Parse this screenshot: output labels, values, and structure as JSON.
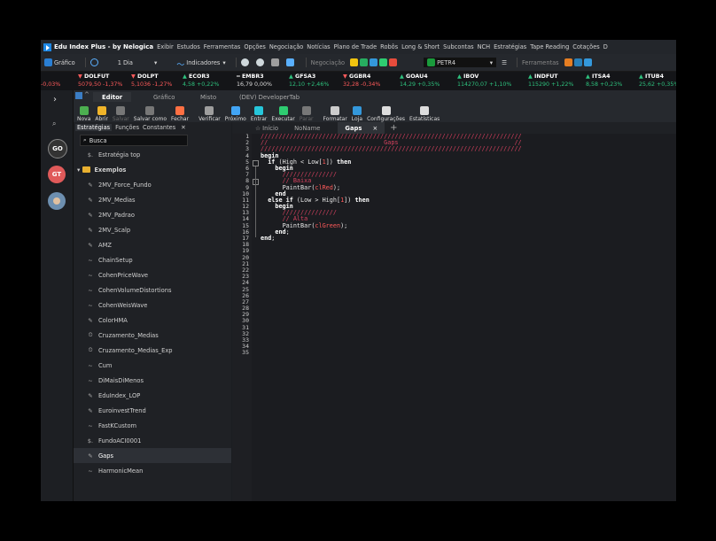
{
  "app": {
    "title": "Edu Index Plus - by Nelogica",
    "menu": [
      "Exibir",
      "Estudos",
      "Ferramentas",
      "Opções",
      "Negociação",
      "Notícias",
      "Plano de Trade",
      "Robôs",
      "Long & Short",
      "Subcontas",
      "NCH",
      "Estratégias",
      "Tape Reading",
      "Cotações",
      "D"
    ]
  },
  "toolbar": {
    "chart_label": "Gráfico",
    "interval": "1 Dia",
    "indicators_label": "Indicadores",
    "trading_label": "Negociação",
    "symbol": "PETR4",
    "tools_label": "Ferramentas"
  },
  "tickers": [
    {
      "name": "",
      "value": "",
      "change": "-0,03%",
      "dir": "down"
    },
    {
      "name": "DOLFUT",
      "value": "5079,50",
      "change": "-1,37%",
      "dir": "down"
    },
    {
      "name": "DOLPT",
      "value": "5,1036",
      "change": "-1,27%",
      "dir": "down"
    },
    {
      "name": "ECOR3",
      "value": "4,58",
      "change": "+0,22%",
      "dir": "up"
    },
    {
      "name": "EMBR3",
      "value": "16,79",
      "change": "0,00%",
      "dir": "flat"
    },
    {
      "name": "GFSA3",
      "value": "12,10",
      "change": "+2,46%",
      "dir": "up"
    },
    {
      "name": "GGBR4",
      "value": "32,28",
      "change": "-0,34%",
      "dir": "down"
    },
    {
      "name": "GOAU4",
      "value": "14,29",
      "change": "+0,35%",
      "dir": "up"
    },
    {
      "name": "IBOV",
      "value": "114270,07",
      "change": "+1,10%",
      "dir": "up"
    },
    {
      "name": "INDFUT",
      "value": "115290",
      "change": "+1,22%",
      "dir": "up"
    },
    {
      "name": "ITSA4",
      "value": "8,58",
      "change": "+0,23%",
      "dir": "up"
    },
    {
      "name": "ITUB4",
      "value": "25,62",
      "change": "+0,35%",
      "dir": "up"
    }
  ],
  "leftnav": {
    "badges": [
      "GO",
      "GT"
    ]
  },
  "editor_tabs": [
    "Editor",
    "Gráfico",
    "Misto",
    "(DEV) DeveloperTab"
  ],
  "ribbon": [
    {
      "label": "Nova",
      "color": "#4caf50"
    },
    {
      "label": "Abrir",
      "color": "#f0b429"
    },
    {
      "label": "Salvar",
      "color": "#777",
      "disabled": true
    },
    {
      "label": "Salvar como",
      "color": "#777"
    },
    {
      "label": "Fechar",
      "color": "#ff7043"
    },
    {
      "label": "Verificar",
      "color": "#9e9e9e"
    },
    {
      "label": "Próximo",
      "color": "#42a5f5"
    },
    {
      "label": "Entrar",
      "color": "#26c6da"
    },
    {
      "label": "Executar",
      "color": "#2ecc71"
    },
    {
      "label": "Parar",
      "color": "#777",
      "disabled": true
    },
    {
      "label": "Formatar",
      "color": "#ccc"
    },
    {
      "label": "Loja",
      "color": "#3498db"
    },
    {
      "label": "Configurações",
      "color": "#ddd"
    },
    {
      "label": "Estatísticas",
      "color": "#ddd"
    }
  ],
  "panel": {
    "tabs": [
      "Estratégias",
      "Funções",
      "Constantes"
    ],
    "search_placeholder": "Busca",
    "items": [
      {
        "label": "Estratégia top",
        "icon": "$",
        "type": "strategy"
      },
      {
        "label": "Exemplos",
        "icon": "folder",
        "type": "folder"
      },
      {
        "label": "2MV_Force_Fundo",
        "icon": "✎",
        "type": "item"
      },
      {
        "label": "2MV_Medias",
        "icon": "✎",
        "type": "item"
      },
      {
        "label": "2MV_Padrao",
        "icon": "✎",
        "type": "item"
      },
      {
        "label": "2MV_Scalp",
        "icon": "✎",
        "type": "item"
      },
      {
        "label": "AMZ",
        "icon": "✎",
        "type": "item"
      },
      {
        "label": "ChainSetup",
        "icon": "~",
        "type": "item"
      },
      {
        "label": "CohenPriceWave",
        "icon": "~",
        "type": "item"
      },
      {
        "label": "CohenVolumeDistortions",
        "icon": "~",
        "type": "item"
      },
      {
        "label": "CohenWeisWave",
        "icon": "~",
        "type": "item"
      },
      {
        "label": "ColorHMA",
        "icon": "✎",
        "type": "item"
      },
      {
        "label": "Cruzamento_Medias",
        "icon": "⏲",
        "type": "item"
      },
      {
        "label": "Cruzamento_Medias_Exp",
        "icon": "⏲",
        "type": "item"
      },
      {
        "label": "Cum",
        "icon": "~",
        "type": "item"
      },
      {
        "label": "DiMaisDiMenos",
        "icon": "~",
        "type": "item"
      },
      {
        "label": "EduIndex_LOP",
        "icon": "✎",
        "type": "item"
      },
      {
        "label": "EuroinvestTrend",
        "icon": "✎",
        "type": "item"
      },
      {
        "label": "FastKCustom",
        "icon": "~",
        "type": "item"
      },
      {
        "label": "FundoACI0001",
        "icon": "$",
        "type": "strategy"
      },
      {
        "label": "Gaps",
        "icon": "✎",
        "type": "item",
        "selected": true
      },
      {
        "label": "HarmonicMean",
        "icon": "~",
        "type": "item"
      }
    ]
  },
  "file_tabs": [
    "Início",
    "NoName",
    "Gaps"
  ],
  "code": {
    "line_numbers": [
      "1",
      "2",
      "3",
      "4",
      "5",
      "6",
      "7",
      "8",
      "9",
      "10",
      "11",
      "12",
      "13",
      "14",
      "15",
      "16",
      "17",
      "18",
      "19",
      "20",
      "21",
      "22",
      "23",
      "24",
      "25",
      "26",
      "27",
      "28",
      "29",
      "30",
      "31",
      "32",
      "33",
      "34",
      "35"
    ],
    "lines": [
      "////////////////////////////////////////////////////////////////////////",
      "//                                Gaps                                //",
      "////////////////////////////////////////////////////////////////////////",
      "begin",
      "  if (High < Low[1]) then",
      "    begin",
      "      ///////////////",
      "      // Baixa",
      "      PaintBar(clRed);",
      "    end",
      "  else if (Low > High[1]) then",
      "    begin",
      "      ///////////////",
      "      // Alta",
      "      PaintBar(clGreen);",
      "    end;",
      "end;"
    ]
  }
}
